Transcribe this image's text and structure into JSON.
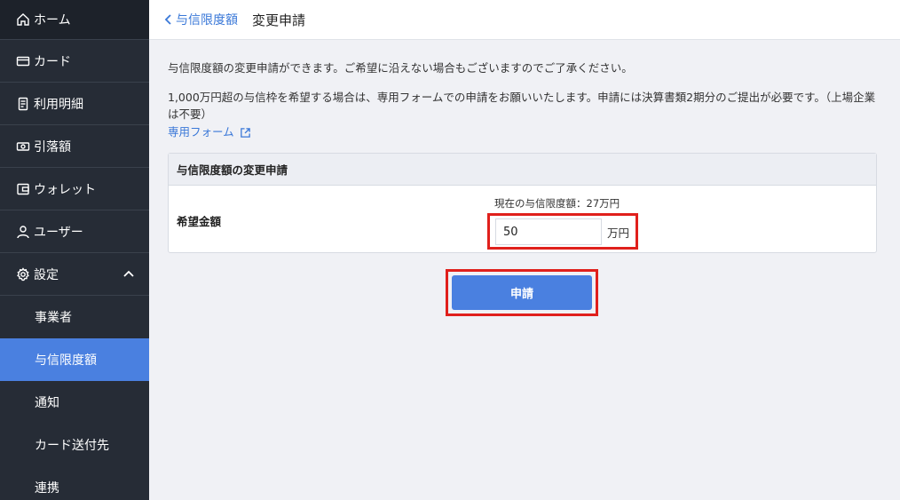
{
  "sidebar": {
    "items": [
      {
        "label": "ホーム",
        "icon": "home-icon"
      },
      {
        "label": "カード",
        "icon": "card-icon"
      },
      {
        "label": "利用明細",
        "icon": "statement-icon"
      },
      {
        "label": "引落額",
        "icon": "money-icon"
      },
      {
        "label": "ウォレット",
        "icon": "wallet-icon"
      },
      {
        "label": "ユーザー",
        "icon": "user-icon"
      },
      {
        "label": "設定",
        "icon": "gear-icon"
      }
    ],
    "settings_sub": [
      {
        "label": "事業者"
      },
      {
        "label": "与信限度額"
      },
      {
        "label": "通知"
      },
      {
        "label": "カード送付先"
      },
      {
        "label": "連携"
      }
    ]
  },
  "header": {
    "back_label": "与信限度額",
    "title": "変更申請"
  },
  "content": {
    "description1": "与信限度額の変更申請ができます。ご希望に沿えない場合もございますのでご了承ください。",
    "description2": "1,000万円超の与信枠を希望する場合は、専用フォームでの申請をお願いいたします。申請には決算書類2期分のご提出が必要です。（上場企業は不要）",
    "form_link": "専用フォーム"
  },
  "panel": {
    "title": "与信限度額の変更申請",
    "field_label": "希望金額",
    "current_limit": "現在の与信限度額：27万円",
    "amount_value": "50",
    "unit": "万円"
  },
  "actions": {
    "submit_label": "申請"
  },
  "colors": {
    "sidebar_bg": "#262c36",
    "accent": "#4a80e0",
    "link": "#3a78d8",
    "highlight": "#e0201c"
  }
}
